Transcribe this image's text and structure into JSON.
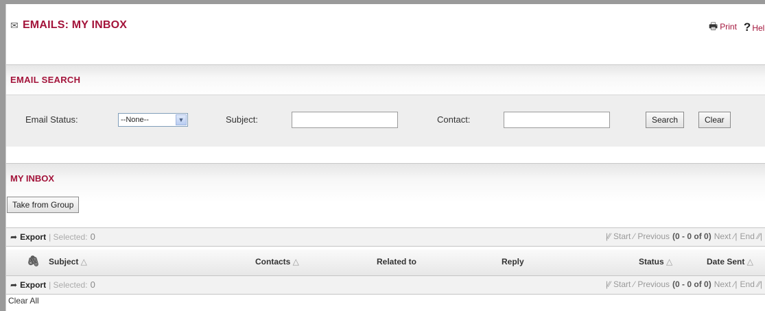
{
  "header": {
    "title": "EMAILS: MY INBOX",
    "print_label": "Print",
    "help_label": "Help"
  },
  "search_section": {
    "title": "EMAIL SEARCH",
    "status_label": "Email Status:",
    "status_value": "--None--",
    "subject_label": "Subject:",
    "subject_value": "",
    "contact_label": "Contact:",
    "contact_value": "",
    "search_button": "Search",
    "clear_button": "Clear"
  },
  "inbox": {
    "title": "MY INBOX",
    "take_button": "Take from Group",
    "toolbar": {
      "export_label": "Export",
      "selected_label": "| Selected:",
      "selected_count": "0",
      "start": "Start",
      "previous": "Previous",
      "range": "(0 - 0 of 0)",
      "next": "Next",
      "end": "End"
    },
    "columns": [
      "Subject",
      "Contacts",
      "Related to",
      "Reply",
      "Status",
      "Date Sent"
    ],
    "clear_all": "Clear All"
  },
  "icons": {
    "title": "envelope-icon",
    "print": "printer-icon",
    "help": "question-icon",
    "attachment": "paperclip-icon",
    "export": "arrow-right-icon"
  },
  "colors": {
    "accent": "#a3133a"
  }
}
